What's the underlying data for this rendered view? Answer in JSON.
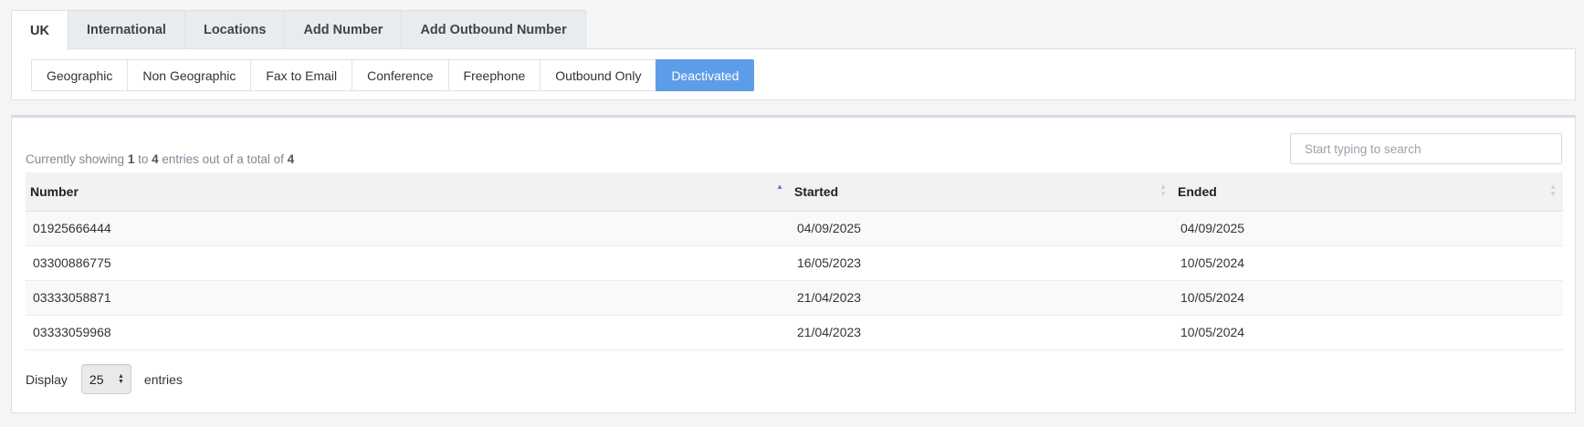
{
  "top_tabs": [
    {
      "label": "UK",
      "active": true
    },
    {
      "label": "International",
      "active": false
    },
    {
      "label": "Locations",
      "active": false
    },
    {
      "label": "Add Number",
      "active": false
    },
    {
      "label": "Add Outbound Number",
      "active": false
    }
  ],
  "sub_tabs": [
    {
      "label": "Geographic",
      "active": false
    },
    {
      "label": "Non Geographic",
      "active": false
    },
    {
      "label": "Fax to Email",
      "active": false
    },
    {
      "label": "Conference",
      "active": false
    },
    {
      "label": "Freephone",
      "active": false
    },
    {
      "label": "Outbound Only",
      "active": false
    },
    {
      "label": "Deactivated",
      "active": true
    }
  ],
  "search": {
    "placeholder": "Start typing to search",
    "value": ""
  },
  "summary": {
    "prefix": "Currently showing",
    "from": "1",
    "to_word": "to",
    "to": "4",
    "middle": "entries out of a total of",
    "total": "4"
  },
  "table": {
    "columns": [
      {
        "label": "Number",
        "sort": "asc"
      },
      {
        "label": "Started",
        "sort": "none"
      },
      {
        "label": "Ended",
        "sort": "none"
      }
    ],
    "rows": [
      [
        "01925666444",
        "04/09/2025",
        "04/09/2025"
      ],
      [
        "03300886775",
        "16/05/2023",
        "10/05/2024"
      ],
      [
        "03333058871",
        "21/04/2023",
        "10/05/2024"
      ],
      [
        "03333059968",
        "21/04/2023",
        "10/05/2024"
      ]
    ]
  },
  "display": {
    "label": "Display",
    "value": "25",
    "suffix": "entries"
  },
  "colors": {
    "accent": "#5d9de8",
    "sort_active": "#5a6fd6"
  },
  "icons": {
    "sort_asc": "sort-asc-icon",
    "sort_both": "sort-both-icon",
    "select_arrows": "select-arrows-icon"
  }
}
